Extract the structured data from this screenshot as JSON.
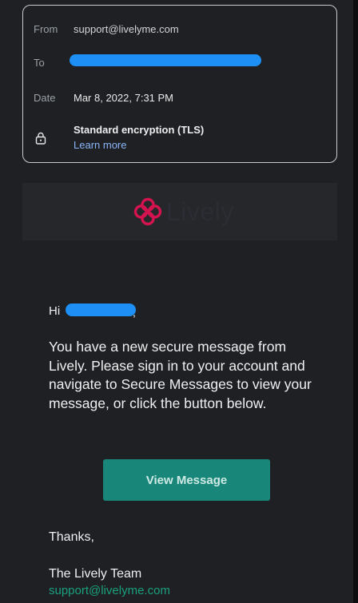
{
  "header": {
    "from_label": "From",
    "from_value": "support@livelyme.com",
    "to_label": "To",
    "to_value": "",
    "date_label": "Date",
    "date_value": "Mar 8, 2022, 7:31 PM",
    "encryption_title": "Standard encryption (TLS)",
    "encryption_link": "Learn more"
  },
  "banner": {
    "logo_text": "Lively"
  },
  "body": {
    "greeting": "Hi",
    "greeting_comma": ",",
    "message": "You have a new secure message from Lively. Please sign in to your account and navigate to Secure Messages to view your message, or click the button below.",
    "button_label": "View Message",
    "thanks": "Thanks,",
    "signoff": "The Lively Team",
    "support_email": "support@livelyme.com"
  },
  "colors": {
    "background": "#1f2023",
    "accent_button": "#18877a",
    "link_blue": "#8ab4f8",
    "link_green": "#1aa07f",
    "logo_pink": "#d4134f",
    "redaction": "#1e8ff5"
  },
  "icons": [
    "lock-icon",
    "lively-logo-icon"
  ]
}
